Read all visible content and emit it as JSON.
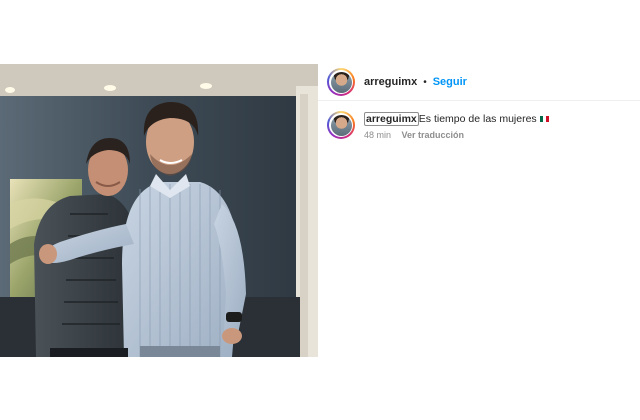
{
  "post": {
    "username": "arreguimx",
    "separator": "•",
    "follow_label": "Seguir"
  },
  "caption": {
    "username": "arreguimx",
    "text": "Es tiempo de las mujeres",
    "flag_icon": "mexico-flag-icon",
    "time": "48 min",
    "translate_label": "Ver traducción"
  },
  "colors": {
    "follow": "#0095f6",
    "text": "#262626",
    "secondary": "#8e8e8e"
  }
}
